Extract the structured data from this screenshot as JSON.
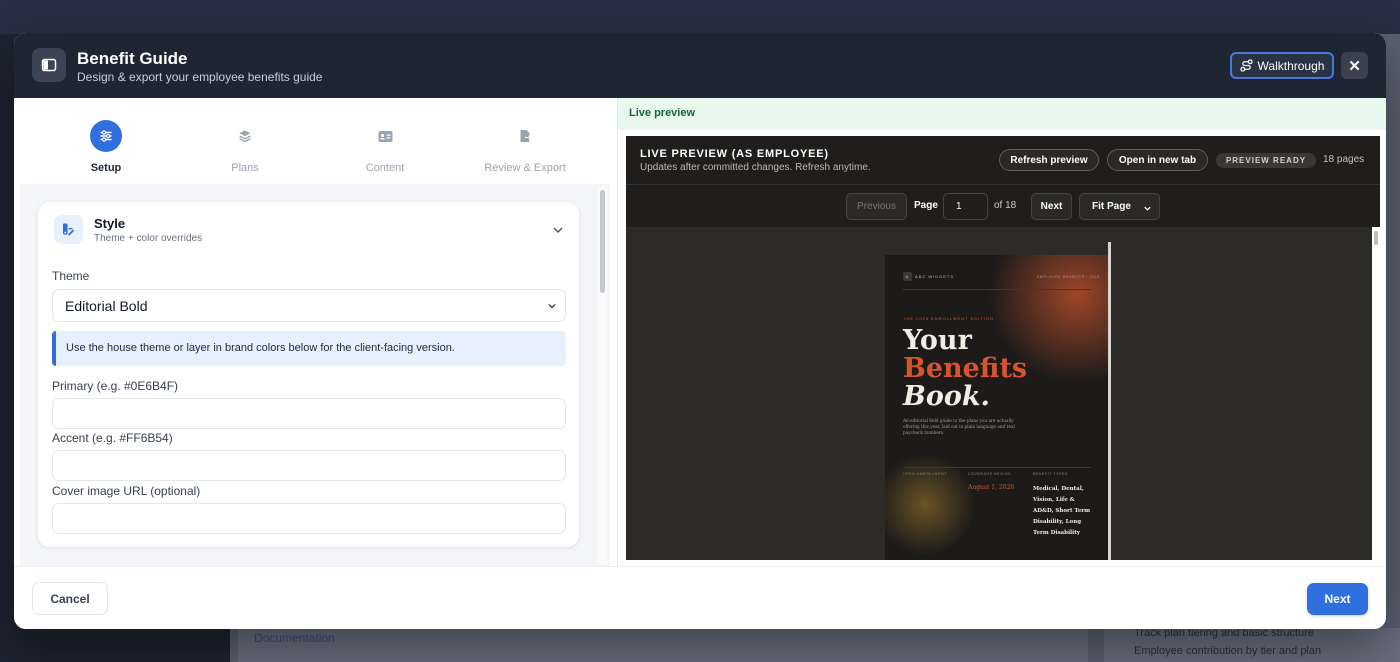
{
  "background": {
    "text1": "Documentation",
    "text2": "Track plan tiering and basic structure",
    "text3": "Employee contribution by tier and plan"
  },
  "modal": {
    "title": "Benefit Guide",
    "subtitle": "Design & export your employee benefits guide",
    "walkthrough_label": "Walkthrough",
    "close_label": "✕"
  },
  "steps": [
    {
      "label": "Setup",
      "icon": "sliders-icon",
      "active": true
    },
    {
      "label": "Plans",
      "icon": "layers-icon",
      "active": false
    },
    {
      "label": "Content",
      "icon": "id-card-icon",
      "active": false
    },
    {
      "label": "Review & Export",
      "icon": "file-export-icon",
      "active": false
    }
  ],
  "style_card": {
    "title": "Style",
    "subtitle": "Theme + color overrides",
    "theme_label": "Theme",
    "theme_value": "Editorial Bold",
    "info_text": "Use the house theme or layer in brand colors below for the client-facing version.",
    "primary_label": "Primary (e.g. #0E6B4F)",
    "primary_value": "",
    "accent_label": "Accent (e.g. #FF6B54)",
    "accent_value": "",
    "cover_label": "Cover image URL (optional)",
    "cover_value": ""
  },
  "preview": {
    "bar_label": "Live preview",
    "title": "LIVE PREVIEW (AS EMPLOYEE)",
    "subtitle": "Updates after committed changes. Refresh anytime.",
    "refresh_label": "Refresh preview",
    "open_label": "Open in new tab",
    "status": "PREVIEW READY",
    "pages": "18 pages",
    "prev_label": "Previous",
    "page_label": "Page",
    "page_value": "1",
    "of_label": "of 18",
    "next_label": "Next",
    "zoom_value": "Fit Page"
  },
  "doc_page": {
    "brand_mark": "A",
    "brand": "ABC WIDGETS",
    "top_right": "EMPLOYEE BENEFITS · 2026",
    "edition": "THE 2026 ENROLLMENT EDITION",
    "head1": "Your",
    "head2": "Benefits",
    "head3": "Book.",
    "desc": "An editorial field guide to the plans you are actually offering this year, laid out in plain language and real paycheck numbers.",
    "col1": "OPEN ENROLLMENT",
    "col2": "COVERAGE BEGINS",
    "col3": "BENEFIT TYPES",
    "date": "August 1, 2026",
    "plans": "Medical, Dental, Vision, Life & AD&D, Short Term Disability, Long Term Disability"
  },
  "footer": {
    "cancel_label": "Cancel",
    "next_label": "Next"
  },
  "colors": {
    "accent": "#2f6fe0",
    "header_bg": "#1e2533",
    "preview_accent": "#d8542e"
  }
}
